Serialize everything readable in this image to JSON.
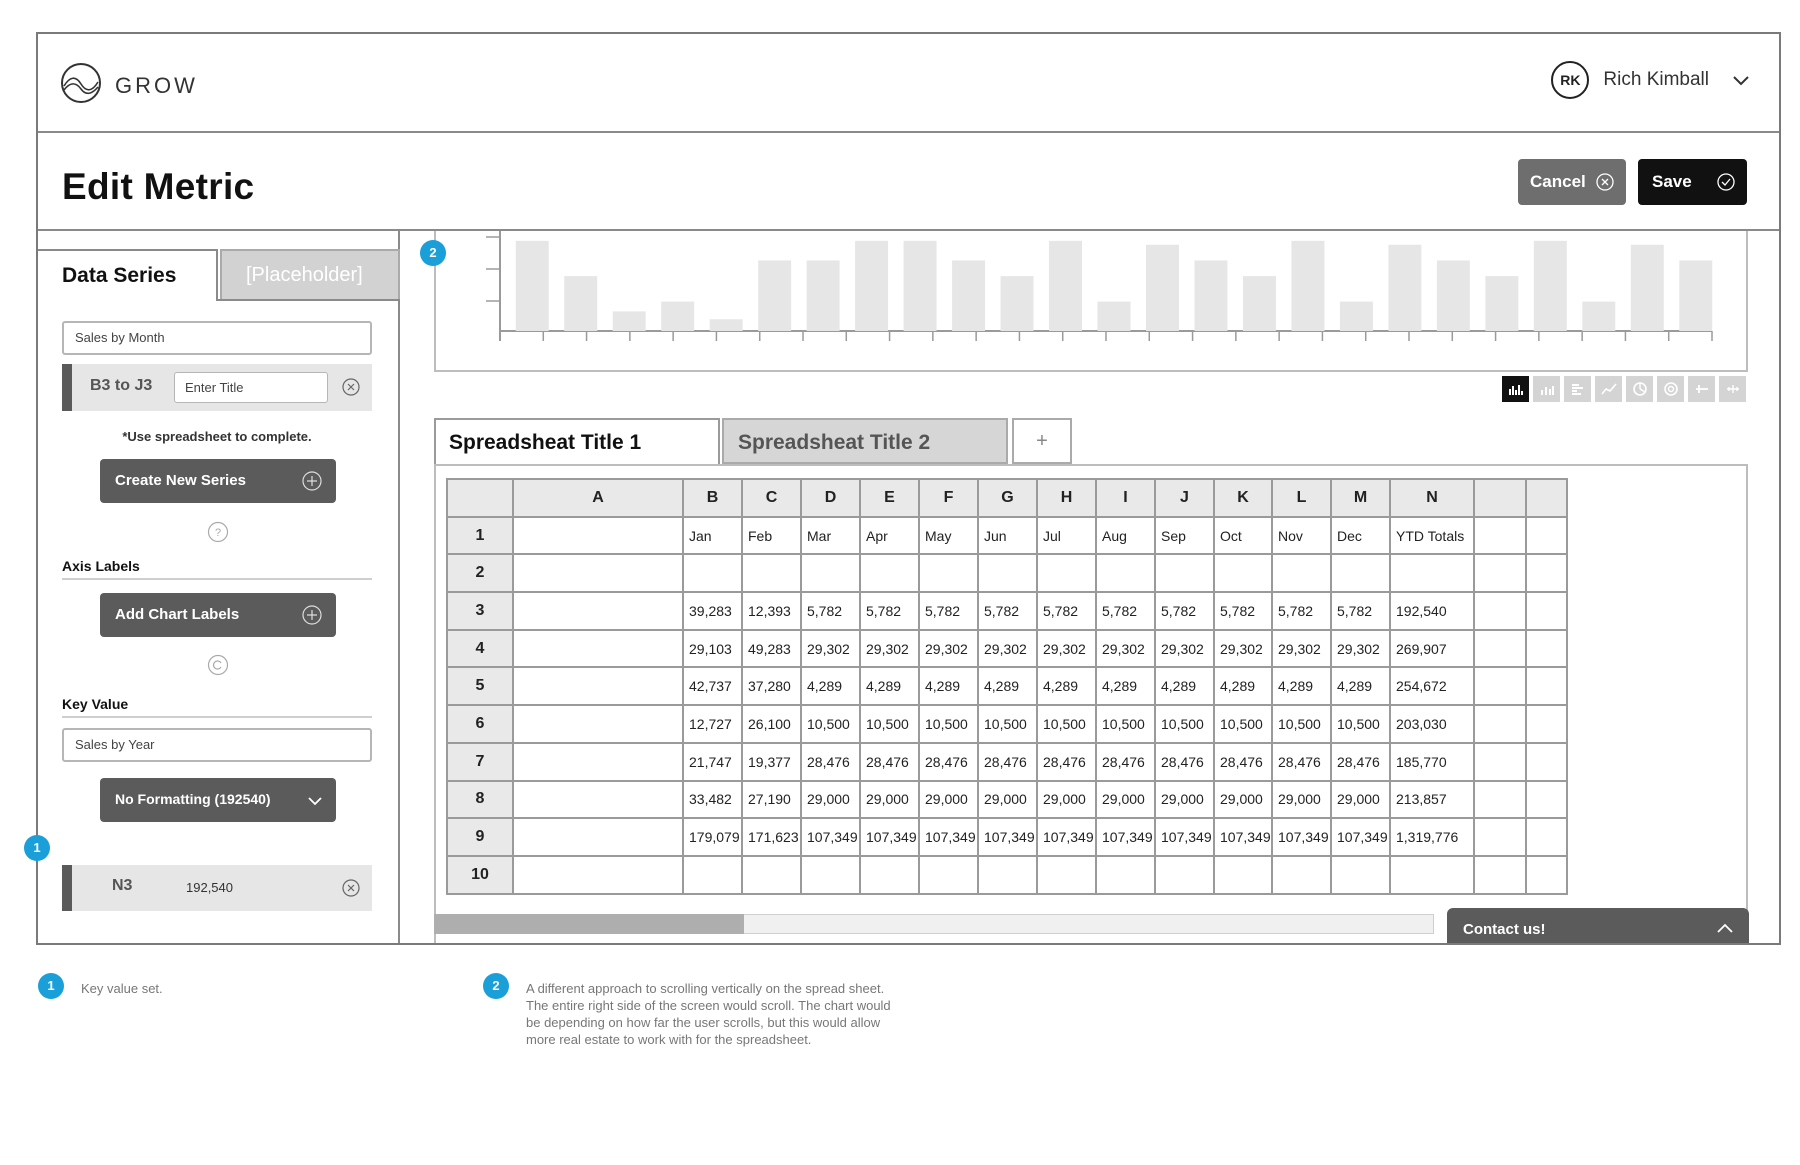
{
  "app": {
    "logo_text": "GROW"
  },
  "user": {
    "initials": "RK",
    "name": "Rich Kimball"
  },
  "page": {
    "title": "Edit Metric",
    "cancel_label": "Cancel",
    "save_label": "Save"
  },
  "left_panel": {
    "tabs": [
      "Data Series",
      "[Placeholder]"
    ],
    "series_name_value": "Sales by Month",
    "series_range": "B3 to J3",
    "series_title_placeholder": "Enter Title",
    "note": "*Use spreadsheet to complete.",
    "create_series_label": "Create New Series",
    "axis_labels_heading": "Axis Labels",
    "add_chart_labels": "Add Chart Labels",
    "key_value_heading": "Key Value",
    "key_value_name": "Sales by Year",
    "formatting_label": "No Formatting (192540)",
    "key_cell": "N3",
    "key_cell_value": "192,540"
  },
  "chart_preview": {
    "bar_levels": [
      0.92,
      0.56,
      0.2,
      0.3,
      0.12,
      0.72,
      0.72,
      0.92,
      0.92,
      0.72,
      0.56,
      0.92,
      0.3,
      0.88,
      0.72,
      0.56,
      0.92,
      0.3,
      0.88,
      0.72,
      0.56,
      0.92,
      0.3,
      0.88,
      0.72
    ],
    "types": [
      "bar",
      "stacked-bar",
      "horizontal-bar",
      "line",
      "pie",
      "donut",
      "bullet",
      "gauge"
    ],
    "active_type": "bar"
  },
  "spreadsheet": {
    "tabs": [
      "Spreadsheat Title 1",
      "Spreadsheat Title 2"
    ],
    "add_tab_label": "+",
    "columns": [
      "A",
      "B",
      "C",
      "D",
      "E",
      "F",
      "G",
      "H",
      "I",
      "J",
      "K",
      "L",
      "M",
      "N",
      "",
      ""
    ],
    "rows": [
      {
        "num": "1",
        "cells": [
          "",
          "Jan",
          "Feb",
          "Mar",
          "Apr",
          "May",
          "Jun",
          "Jul",
          "Aug",
          "Sep",
          "Oct",
          "Nov",
          "Dec",
          "YTD Totals",
          "",
          ""
        ]
      },
      {
        "num": "2",
        "cells": [
          "",
          "",
          "",
          "",
          "",
          "",
          "",
          "",
          "",
          "",
          "",
          "",
          "",
          "",
          "",
          ""
        ]
      },
      {
        "num": "3",
        "cells": [
          "",
          "39,283",
          "12,393",
          "5,782",
          "5,782",
          "5,782",
          "5,782",
          "5,782",
          "5,782",
          "5,782",
          "5,782",
          "5,782",
          "5,782",
          "192,540",
          "",
          ""
        ]
      },
      {
        "num": "4",
        "cells": [
          "",
          "29,103",
          "49,283",
          "29,302",
          "29,302",
          "29,302",
          "29,302",
          "29,302",
          "29,302",
          "29,302",
          "29,302",
          "29,302",
          "29,302",
          "269,907",
          "",
          ""
        ]
      },
      {
        "num": "5",
        "cells": [
          "",
          "42,737",
          "37,280",
          "4,289",
          "4,289",
          "4,289",
          "4,289",
          "4,289",
          "4,289",
          "4,289",
          "4,289",
          "4,289",
          "4,289",
          "254,672",
          "",
          ""
        ]
      },
      {
        "num": "6",
        "cells": [
          "",
          "12,727",
          "26,100",
          "10,500",
          "10,500",
          "10,500",
          "10,500",
          "10,500",
          "10,500",
          "10,500",
          "10,500",
          "10,500",
          "10,500",
          "203,030",
          "",
          ""
        ]
      },
      {
        "num": "7",
        "cells": [
          "",
          "21,747",
          "19,377",
          "28,476",
          "28,476",
          "28,476",
          "28,476",
          "28,476",
          "28,476",
          "28,476",
          "28,476",
          "28,476",
          "28,476",
          "185,770",
          "",
          ""
        ]
      },
      {
        "num": "8",
        "cells": [
          "",
          "33,482",
          "27,190",
          "29,000",
          "29,000",
          "29,000",
          "29,000",
          "29,000",
          "29,000",
          "29,000",
          "29,000",
          "29,000",
          "29,000",
          "213,857",
          "",
          ""
        ]
      },
      {
        "num": "9",
        "cells": [
          "",
          "179,079",
          "171,623",
          "107,349",
          "107,349",
          "107,349",
          "107,349",
          "107,349",
          "107,349",
          "107,349",
          "107,349",
          "107,349",
          "107,349",
          "1,319,776",
          "",
          ""
        ]
      },
      {
        "num": "10",
        "cells": [
          "",
          "",
          "",
          "",
          "",
          "",
          "",
          "",
          "",
          "",
          "",
          "",
          "",
          "",
          "",
          ""
        ]
      }
    ],
    "scroll_position": 0.31
  },
  "contact": {
    "label": "Contact us!"
  },
  "annotations": [
    {
      "num": "1",
      "text": "Key value set."
    },
    {
      "num": "2",
      "text": "A different approach to scrolling vertically on the spread sheet. The entire right side of the screen would scroll. The chart would be depending on how far the user scrolls, but this would allow more real estate to work with for the spreadsheet."
    }
  ],
  "colors": {
    "accent": "#1a9fd8",
    "dark_button": "#111111",
    "gray_button": "#5b5b5b"
  }
}
